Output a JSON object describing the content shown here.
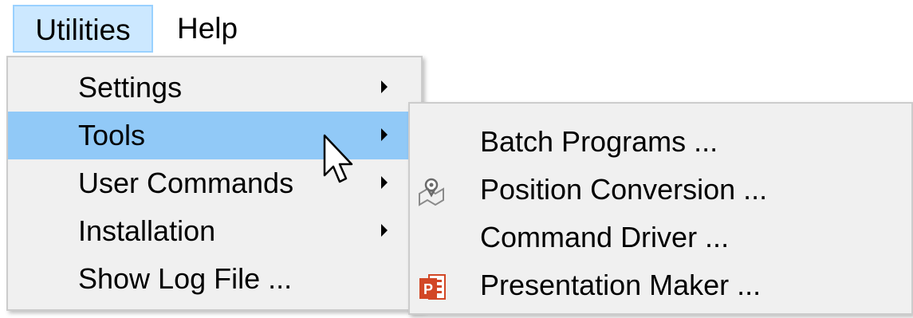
{
  "menubar": {
    "items": [
      {
        "label": "Utilities"
      },
      {
        "label": "Help"
      }
    ]
  },
  "utilities_menu": {
    "items": [
      {
        "label": "Settings",
        "submenu": true
      },
      {
        "label": "Tools",
        "submenu": true
      },
      {
        "label": "User Commands",
        "submenu": true
      },
      {
        "label": "Installation",
        "submenu": true
      },
      {
        "label": "Show Log File ...",
        "submenu": false
      }
    ],
    "highlighted": "Tools"
  },
  "tools_submenu": {
    "items": [
      {
        "label": "Batch Programs ...",
        "icon": ""
      },
      {
        "label": "Position Conversion ...",
        "icon": "map-pin-icon"
      },
      {
        "label": "Command Driver ...",
        "icon": ""
      },
      {
        "label": "Presentation Maker ...",
        "icon": "powerpoint-icon"
      }
    ]
  },
  "colors": {
    "menubar_active_bg": "#cce8ff",
    "menu_bg": "#f0f0f0",
    "highlight_bg": "#91c9f7",
    "powerpoint_red": "#d24726"
  }
}
